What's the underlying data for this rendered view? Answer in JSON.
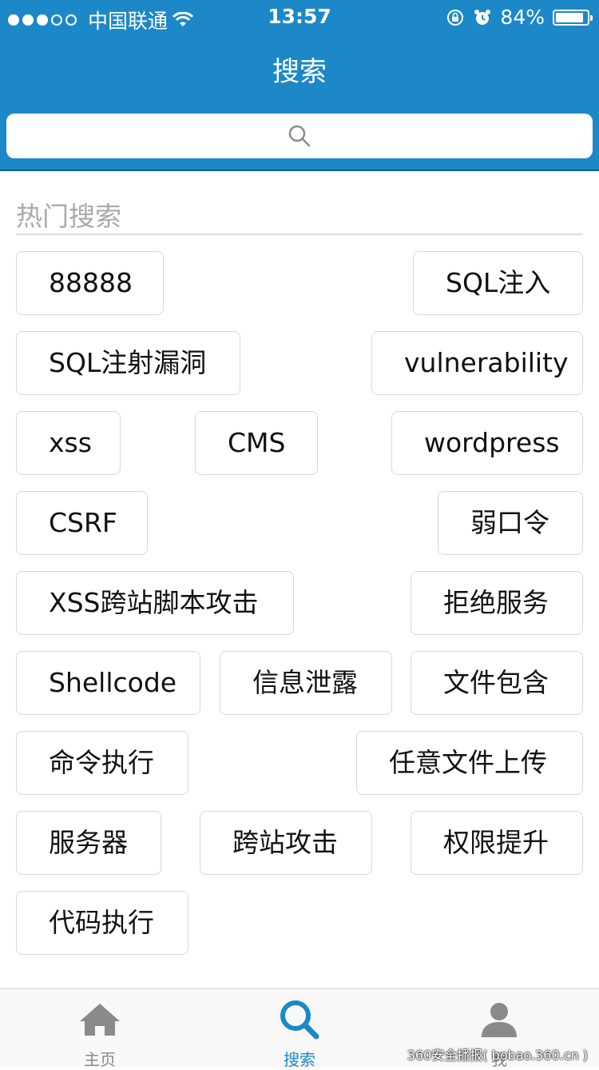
{
  "status_bar": {
    "carrier": "中国联通",
    "time": "13:57",
    "battery": "84%",
    "battery_level": 0.84
  },
  "header": {
    "title": "搜索"
  },
  "search": {
    "placeholder": ""
  },
  "hot": {
    "title": "热门搜索",
    "tags": [
      "88888",
      "SQL注入",
      "SQL注射漏洞",
      "vulnerability",
      "xss",
      "CMS",
      "wordpress",
      "CSRF",
      "弱口令",
      "XSS跨站脚本攻击",
      "拒绝服务",
      "Shellcode",
      "信息泄露",
      "文件包含",
      "命令执行",
      "任意文件上传",
      "服务器",
      "跨站攻击",
      "权限提升",
      "代码执行"
    ]
  },
  "tabbar": {
    "items": [
      {
        "label": "主页",
        "icon": "home-icon",
        "active": false
      },
      {
        "label": "搜索",
        "icon": "search-icon",
        "active": true
      },
      {
        "label": "我",
        "icon": "user-icon",
        "active": false
      }
    ]
  },
  "watermark": "360安全播报( bobao.360.cn )",
  "colors": {
    "header": "#1c88c8",
    "active_tab": "#1c88c8",
    "inactive_tab": "#8a8a8a"
  }
}
